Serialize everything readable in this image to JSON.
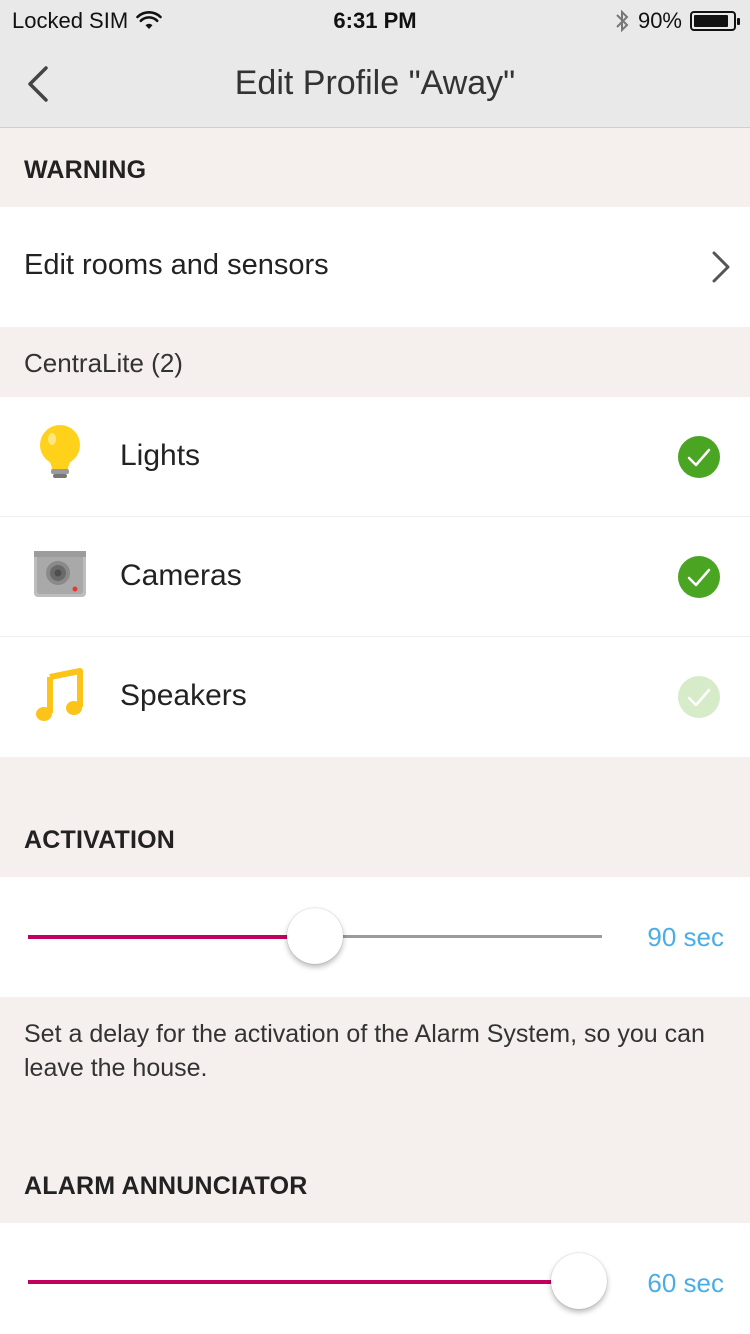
{
  "status_bar": {
    "carrier": "Locked SIM",
    "time": "6:31 PM",
    "battery": "90%",
    "battery_level": 0.9,
    "icons": [
      "wifi-icon",
      "bluetooth-icon",
      "battery-icon"
    ]
  },
  "nav": {
    "title": "Edit Profile \"Away\"",
    "back_icon": "chevron-left-icon"
  },
  "warning_section": {
    "header": "WARNING",
    "edit_row_label": "Edit rooms and sensors"
  },
  "device_group": {
    "title": "CentraLite (2)",
    "items": [
      {
        "label": "Lights",
        "icon": "lightbulb-icon",
        "checked": true
      },
      {
        "label": "Cameras",
        "icon": "camera-icon",
        "checked": true
      },
      {
        "label": "Speakers",
        "icon": "music-note-icon",
        "checked": false
      }
    ]
  },
  "activation": {
    "header": "ACTIVATION",
    "value": "90 sec",
    "slider_fraction": 0.5,
    "description": "Set a delay for the activation of the Alarm System, so you can leave the house."
  },
  "annunciator": {
    "header": "ALARM ANNUNCIATOR",
    "value": "60 sec",
    "slider_fraction": 0.96
  },
  "colors": {
    "accent": "#c4005e",
    "check_on": "#4aa523",
    "check_off": "#d6ecc9",
    "value_text": "#4aaee6",
    "track_off": "#9b9b9b"
  }
}
